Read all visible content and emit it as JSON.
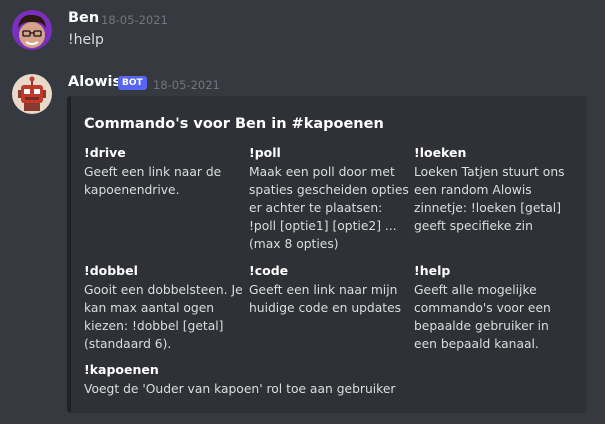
{
  "messages": [
    {
      "username": "Ben",
      "timestamp": "18-05-2021",
      "content": "!help"
    },
    {
      "username": "Alowis",
      "badge": "BOT",
      "timestamp": "18-05-2021",
      "embed": {
        "title": "Commando's voor Ben in #kapoenen",
        "fields": [
          {
            "name": "!drive",
            "value": "Geeft een link naar de kapoenendrive."
          },
          {
            "name": "!poll",
            "value": "Maak een poll door met spaties gescheiden opties er achter te plaatsen: !poll [optie1] [optie2] ... (max 8 opties)"
          },
          {
            "name": "!loeken",
            "value": "Loeken Tatjen stuurt ons een random Alowis zinnetje: !loeken [getal] geeft specifieke zin"
          },
          {
            "name": "!dobbel",
            "value": "Gooit een dobbelsteen. Je kan max aantal ogen kiezen: !dobbel [getal] (standaard 6)."
          },
          {
            "name": "!code",
            "value": "Geeft een link naar mijn huidige code en updates"
          },
          {
            "name": "!help",
            "value": "Geeft alle mogelijke commando's voor een bepaalde gebruiker in een bepaald kanaal."
          },
          {
            "name": "!kapoenen",
            "value": "Voegt de 'Ouder van kapoen' rol toe aan gebruiker"
          }
        ]
      }
    }
  ],
  "colors": {
    "background": "#36393f",
    "embed_bg": "#2f3136",
    "bot_badge": "#5865f2",
    "timestamp": "#72767d"
  }
}
